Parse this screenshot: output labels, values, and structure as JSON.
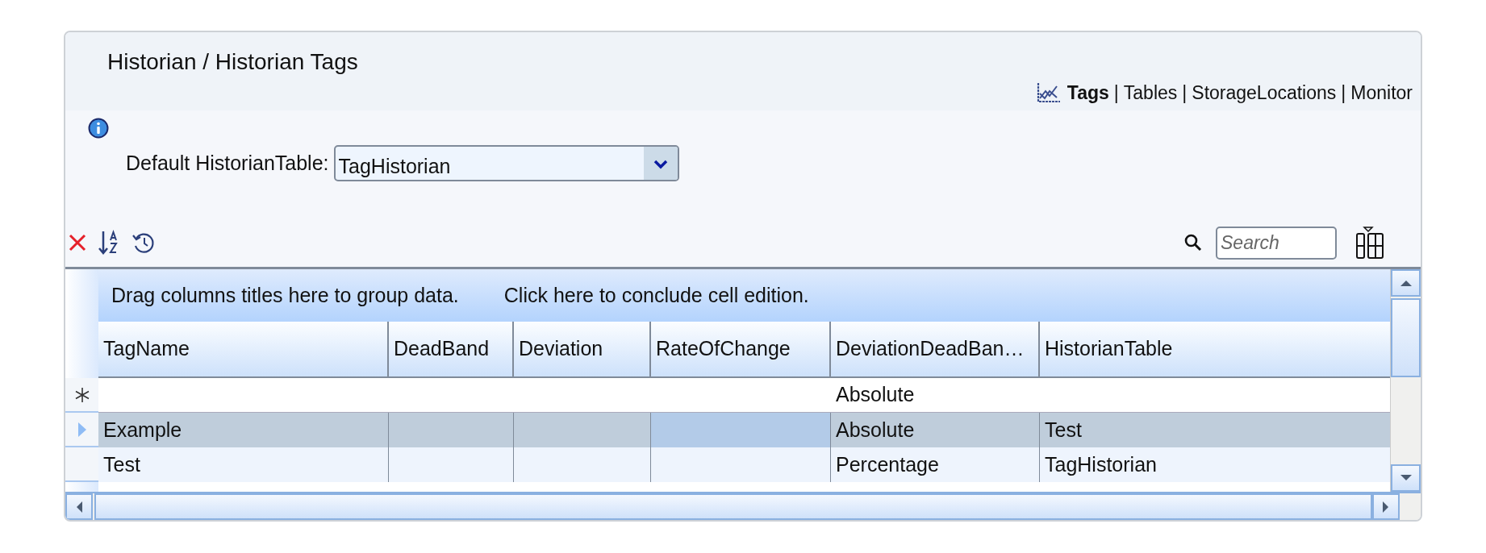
{
  "breadcrumb": "Historian / Historian Tags",
  "nav": [
    {
      "label": "Tags",
      "selected": true
    },
    {
      "label": "Tables",
      "selected": false,
      "separator": "|"
    },
    {
      "label": "StorageLocations",
      "selected": false,
      "separator": "|"
    },
    {
      "label": "Monitor",
      "selected": false,
      "separator": "|"
    }
  ],
  "default_table": {
    "label": "Default HistorianTable:",
    "value": "TagHistorian"
  },
  "search": {
    "placeholder": "Search"
  },
  "grid": {
    "group_panel": [
      "Drag columns titles here to group data.",
      "Click here to conclude cell edition."
    ],
    "columns": [
      {
        "label": "TagName",
        "current": false
      },
      {
        "label": "DeadBand",
        "current": false
      },
      {
        "label": "Deviation",
        "current": false
      },
      {
        "label": "RateOfChange",
        "current": true
      },
      {
        "label": "DeviationDeadBan…",
        "current": false
      },
      {
        "label": "HistorianTable",
        "current": false
      }
    ],
    "rows": [
      {
        "kind": "new",
        "selected": false,
        "cells": [
          null,
          null,
          null,
          null,
          "Absolute",
          null
        ]
      },
      {
        "kind": "current",
        "selected": true,
        "cells": [
          "Example",
          null,
          null,
          null,
          "Absolute",
          "Test"
        ]
      },
      {
        "kind": "plain",
        "selected": false,
        "cells": [
          "Test",
          null,
          null,
          null,
          "Percentage",
          "TagHistorian"
        ]
      }
    ]
  }
}
